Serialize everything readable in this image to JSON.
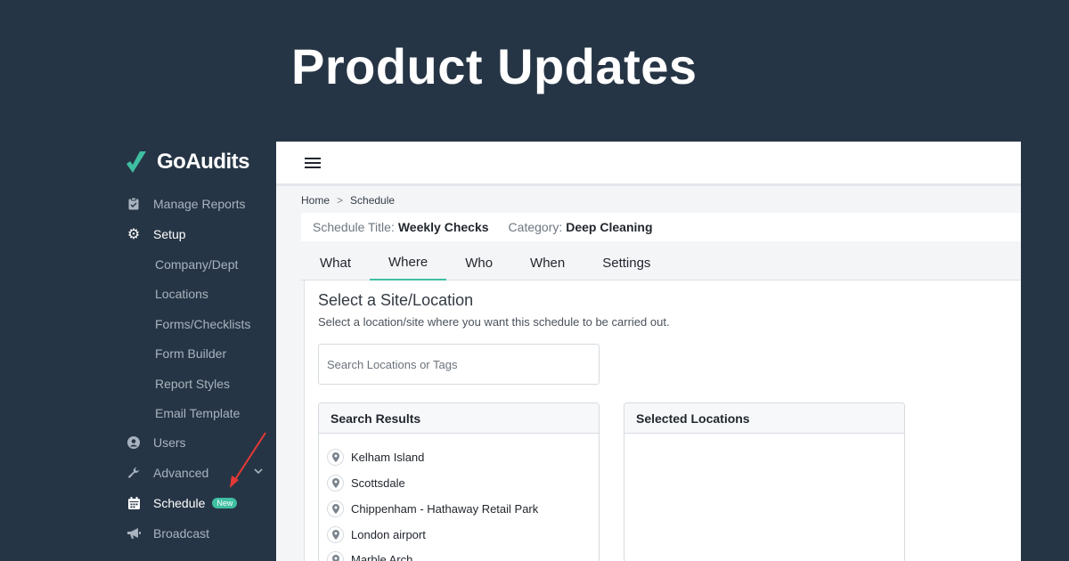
{
  "headline": "Product Updates",
  "logo": {
    "text": "GoAudits",
    "icon": "check-logo-icon",
    "brand_color": "#3fbfa2"
  },
  "sidebar": {
    "items": [
      {
        "label": "Manage Reports",
        "icon": "clipboard-icon"
      },
      {
        "label": "Setup",
        "icon": "gear-icon"
      },
      {
        "label": "Company/Dept"
      },
      {
        "label": "Locations"
      },
      {
        "label": "Forms/Checklists"
      },
      {
        "label": "Form Builder"
      },
      {
        "label": "Report Styles"
      },
      {
        "label": "Email Template"
      },
      {
        "label": "Users",
        "icon": "user-icon"
      },
      {
        "label": "Advanced",
        "icon": "wrench-icon"
      },
      {
        "label": "Schedule",
        "icon": "calendar-icon",
        "badge": "New"
      },
      {
        "label": "Broadcast",
        "icon": "megaphone-icon"
      }
    ]
  },
  "breadcrumb": {
    "home": "Home",
    "separator": ">",
    "current": "Schedule"
  },
  "schedule": {
    "title_label": "Schedule Title:",
    "title_value": "Weekly Checks",
    "category_label": "Category:",
    "category_value": "Deep Cleaning"
  },
  "tabs": [
    {
      "label": "What"
    },
    {
      "label": "Where",
      "active": true
    },
    {
      "label": "Who"
    },
    {
      "label": "When"
    },
    {
      "label": "Settings"
    }
  ],
  "content": {
    "title": "Select a Site/Location",
    "subtitle": "Select a location/site where you want this schedule to be carried out.",
    "search_placeholder": "Search Locations or Tags",
    "search_results_title": "Search Results",
    "selected_title": "Selected Locations",
    "results": [
      "Kelham Island",
      "Scottsdale",
      "Chippenham - Hathaway Retail Park",
      "London airport",
      "Marble Arch"
    ]
  },
  "colors": {
    "background": "#263545",
    "accent": "#3fbfa2",
    "arrow": "#e53935"
  }
}
